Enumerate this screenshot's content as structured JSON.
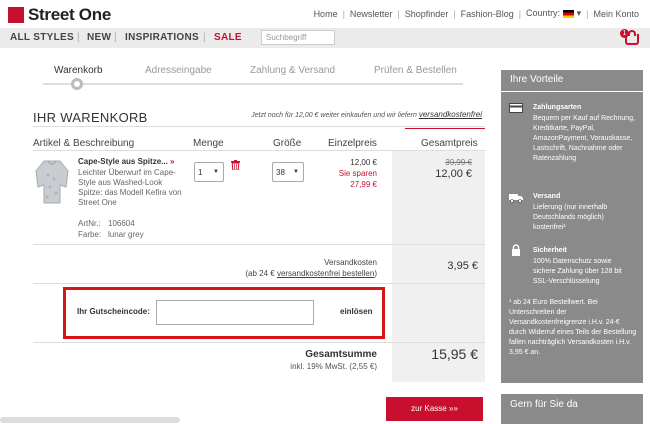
{
  "brand": {
    "name": "Street One",
    "color": "#c8102e"
  },
  "topnav": {
    "home": "Home",
    "newsletter": "Newsletter",
    "shopfinder": "Shopfinder",
    "blog": "Fashion-Blog",
    "country": "Country",
    "account": "Mein Konto"
  },
  "nav": {
    "all_styles": "ALL STYLES",
    "new": "NEW",
    "inspirations": "INSPIRATIONS",
    "sale": "SALE",
    "search_placeholder": "Suchbegriff",
    "basket_count": "1"
  },
  "steps": [
    "Warenkorb",
    "Adresseingabe",
    "Zahlung & Versand",
    "Prüfen & Bestellen"
  ],
  "cart": {
    "title": "IHR WARENKORB",
    "free_shipping_hint": "Jetzt noch für 12,00 € weiter einkaufen und wir liefern",
    "free_shipping_link": "versandkostenfrei",
    "headers": {
      "article": "Artikel & Beschreibung",
      "qty": "Menge",
      "size": "Größe",
      "unit_price": "Einzelpreis",
      "total": "Gesamtpreis"
    },
    "item": {
      "title": "Cape-Style aus Spitze...",
      "arrow": "»",
      "description": "Leichter Überwurf im Cape-Style aus Washed-Look Spitze: das Modell Kefira von Street One",
      "art_label": "ArtNr.:",
      "art_value": "106604",
      "color_label": "Farbe:",
      "color_value": "lunar grey",
      "qty": "1",
      "size": "38",
      "unit_price": "12,00 €",
      "savings_label": "Sie sparen",
      "savings_value": "27,99 €",
      "old_price": "39,99 €",
      "total": "12,00 €"
    },
    "shipping": {
      "label": "Versandkosten",
      "sub_prefix": "(ab 24 €",
      "sub_link": "versandkostenfrei bestellen",
      "sub_suffix": ")",
      "value": "3,95 €"
    },
    "voucher": {
      "label": "Ihr Gutscheincode:",
      "value": "",
      "button": "einlösen"
    },
    "sum": {
      "label": "Gesamtsumme",
      "tax": "inkl. 19% MwSt. (2,55 €)",
      "value": "15,95 €"
    },
    "checkout": "zur Kasse »»"
  },
  "sidebar": {
    "title": "Ihre Vorteile",
    "payment": {
      "title": "Zahlungsarten",
      "text": "Bequem per Kauf auf Rechnung, Kreditkarte, PayPal, AmazonPayment, Vorauskasse, Lastschrift, Nachnahme oder Ratenzahlung"
    },
    "shipping": {
      "title": "Versand",
      "text": "Lieferung (nur innerhalb Deutschlands möglich) kostenfrei¹"
    },
    "security": {
      "title": "Sicherheit",
      "text": "100% Datenschutz sowie sichere Zahlung über 128 bit SSL-Verschlüsselung"
    },
    "footnote": "¹ ab 24 Euro Bestellwert. Bei Unterschreiten der Versandkostenfreigrenze i.H.v. 24-€ durch Widerruf eines Teils der Bestellung fallen nachträglich Versandkosten i.H.v. 3,95 € an.",
    "help_title": "Gern für Sie da"
  }
}
